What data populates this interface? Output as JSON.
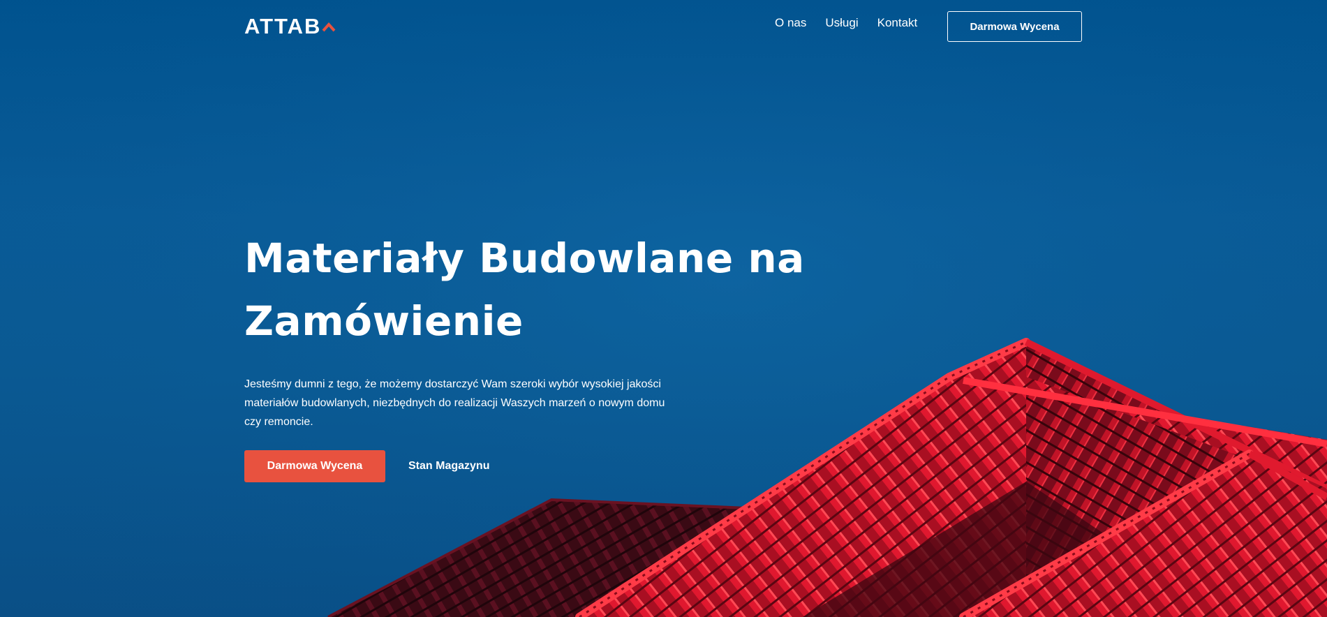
{
  "brand": {
    "name": "ATTAB",
    "caret_icon": "caret-up-icon",
    "caret_color": "#e8523f"
  },
  "nav": {
    "links": [
      "O nas",
      "Usługi",
      "Kontakt"
    ],
    "cta_label": "Darmowa Wycena"
  },
  "hero": {
    "title": "Materiały Budowlane na Zamówienie",
    "description": "Jesteśmy dumni z tego, że możemy dostarczyć Wam szeroki wybór wysokiej jakości materiałów budowlanych, niezbędnych do realizacji Waszych marzeń o nowym domu czy remoncie.",
    "primary_cta": "Darmowa Wycena",
    "secondary_cta": "Stan Magazynu",
    "background_image": "red-tiled-roof-photo"
  },
  "colors": {
    "sky": "#0a5c98",
    "accent": "#e8523f",
    "roof_red": "#c8102e",
    "text": "#ffffff"
  }
}
